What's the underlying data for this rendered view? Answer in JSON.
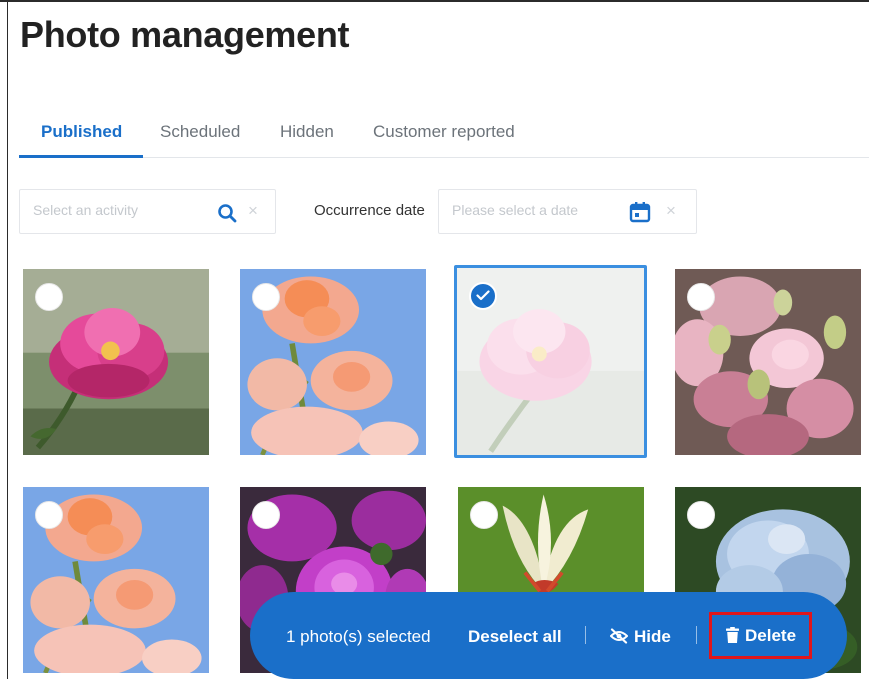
{
  "page": {
    "title": "Photo management"
  },
  "tabs": [
    {
      "label": "Published",
      "active": true
    },
    {
      "label": "Scheduled",
      "active": false
    },
    {
      "label": "Hidden",
      "active": false
    },
    {
      "label": "Customer reported",
      "active": false
    }
  ],
  "filters": {
    "activity": {
      "placeholder": "Select an activity",
      "value": "",
      "icon": "search-icon",
      "clear_icon": "close-icon",
      "clear_glyph": "×"
    },
    "occurrence_date": {
      "label": "Occurrence date",
      "placeholder": "Please select a date",
      "value": "",
      "icon": "calendar-icon",
      "clear_icon": "close-icon",
      "clear_glyph": "×"
    }
  },
  "photos": [
    {
      "subject": "pink peony",
      "selected": false
    },
    {
      "subject": "peach flowers against blue sky",
      "selected": false
    },
    {
      "subject": "pale pink peony",
      "selected": true
    },
    {
      "subject": "pink roses and lisianthus bouquet",
      "selected": false
    },
    {
      "subject": "peach flowers against blue sky",
      "selected": false
    },
    {
      "subject": "purple dahlias",
      "selected": false
    },
    {
      "subject": "white and red tulip",
      "selected": false
    },
    {
      "subject": "blue hydrangea",
      "selected": false
    }
  ],
  "selection_bar": {
    "count_text": "1 photo(s) selected",
    "deselect_label": "Deselect all",
    "separator": "|",
    "hide_label": "Hide",
    "hide_icon": "eye-slash-icon",
    "delete_label": "Delete",
    "delete_icon": "trash-icon"
  },
  "colors": {
    "accent": "#1a6fc9",
    "highlight_border": "#e0161b",
    "selected_photo_border": "#3b8fe0"
  }
}
